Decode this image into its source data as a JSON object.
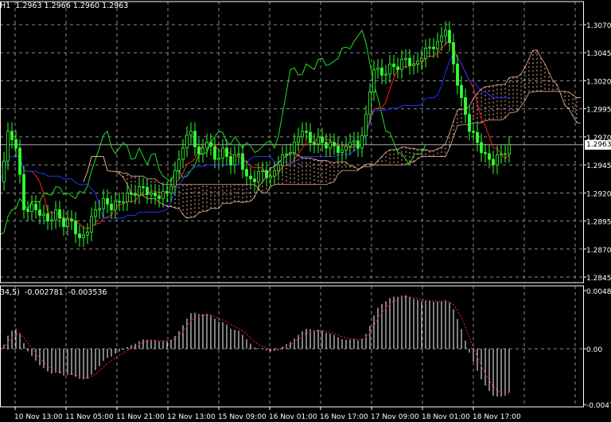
{
  "header": {
    "symbol_period": "H1",
    "ohlc": [
      "1.2963",
      "1.2966",
      "1.2960",
      "1.2963"
    ]
  },
  "macd_header": {
    "params": "34,5)",
    "values": [
      "-0.002781",
      "-0.003536"
    ]
  },
  "current_price": "1.2963",
  "colors": {
    "background": "#000000",
    "grid": "#8a8a8a",
    "candles": "#33ff33",
    "chikou": "#22dd22",
    "tenkan": "#ff2020",
    "kijun": "#2233ff",
    "cloud": "#f0b090",
    "macd_hist": "#ffffff",
    "macd_signal": "#ff2020"
  },
  "chart_data": [
    {
      "type": "line",
      "title": "",
      "price_ticks": [
        "1.3070",
        "1.3045",
        "1.3020",
        "1.2995",
        "1.2970",
        "1.2945",
        "1.2920",
        "1.2895",
        "1.2870",
        "1.2845"
      ],
      "ylim": [
        1.2845,
        1.307
      ],
      "time_ticks": [
        "10 Nov 13:00",
        "11 Nov 05:00",
        "11 Nov 21:00",
        "12 Nov 13:00",
        "15 Nov 09:00",
        "16 Nov 01:00",
        "16 Nov 17:00",
        "17 Nov 09:00",
        "18 Nov 01:00",
        "18 Nov 17:00"
      ],
      "close": [
        1.293,
        1.2975,
        1.296,
        1.2905,
        1.291,
        1.29,
        1.2895,
        1.2905,
        1.289,
        1.2895,
        1.288,
        1.2885,
        1.2905,
        1.2915,
        1.2905,
        1.2912,
        1.292,
        1.2918,
        1.2925,
        1.292,
        1.2915,
        1.292,
        1.294,
        1.296,
        1.2975,
        1.2955,
        1.2965,
        1.295,
        1.296,
        1.2945,
        1.2955,
        1.2935,
        1.293,
        1.294,
        1.2935,
        1.2945,
        1.2955,
        1.2965,
        1.2975,
        1.2965,
        1.297,
        1.296,
        1.2962,
        1.2958,
        1.2965,
        1.296,
        1.299,
        1.303,
        1.3025,
        1.3035,
        1.303,
        1.304,
        1.3035,
        1.304,
        1.305,
        1.3055,
        1.3065,
        1.3035,
        1.3005,
        1.2975,
        1.2965,
        1.2955,
        1.2945,
        1.2955,
        1.2963
      ],
      "indicators": [
        "Ichimoku",
        "MACD"
      ]
    },
    {
      "type": "bar",
      "title": "MACD",
      "ticks": [
        "0.00489",
        "0.00",
        "-0.0047"
      ],
      "ylim": [
        -0.0047,
        0.00489
      ]
    }
  ]
}
